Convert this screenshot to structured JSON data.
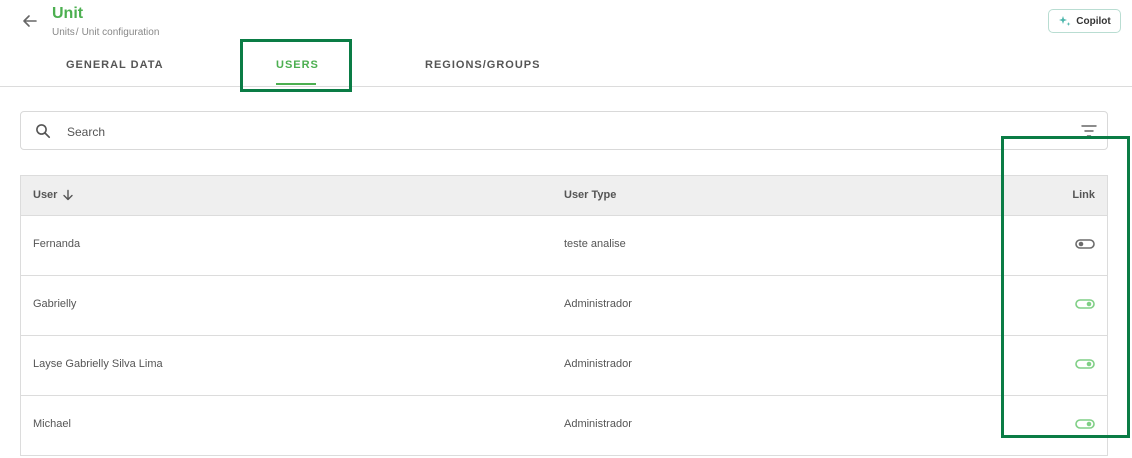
{
  "header": {
    "title": "Unit",
    "breadcrumb": {
      "parent": "Units",
      "separator": "/",
      "current": "Unit configuration"
    },
    "copilot_label": "Copilot"
  },
  "tabs": [
    {
      "label": "GENERAL DATA",
      "active": false
    },
    {
      "label": "USERS",
      "active": true
    },
    {
      "label": "REGIONS/GROUPS",
      "active": false
    }
  ],
  "search": {
    "placeholder": "Search",
    "value": ""
  },
  "table": {
    "columns": {
      "user": "User",
      "user_type": "User Type",
      "link": "Link"
    },
    "sort": "descending",
    "rows": [
      {
        "user": "Fernanda",
        "user_type": "teste analise",
        "linked": false
      },
      {
        "user": "Gabrielly",
        "user_type": "Administrador",
        "linked": true
      },
      {
        "user": "Layse Gabrielly Silva Lima",
        "user_type": "Administrador",
        "linked": true
      },
      {
        "user": "Michael",
        "user_type": "Administrador",
        "linked": true
      }
    ]
  },
  "colors": {
    "accent": "#4caf50",
    "highlight": "#0a7c45",
    "toggle_on": "#7fcf85",
    "toggle_off": "#6b6b6b"
  },
  "icons": {
    "back": "arrow-left-icon",
    "copilot": "sparkle-icon",
    "search": "search-icon",
    "filter": "filter-icon",
    "sort": "arrow-down-icon",
    "toggle": "toggle-switch-icon"
  }
}
